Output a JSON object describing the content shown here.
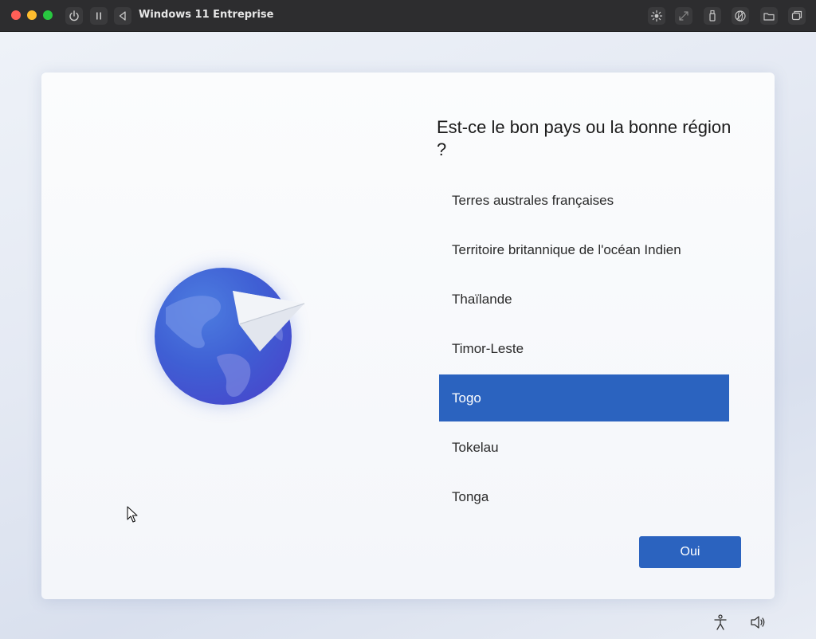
{
  "window": {
    "title": "Windows 11 Entreprise",
    "controls": [
      "power-icon",
      "pause-icon",
      "back-icon"
    ],
    "toolbar_icons": [
      "brightness-icon",
      "resize-icon",
      "usb-icon",
      "network-icon",
      "folder-icon",
      "windows-icon"
    ]
  },
  "setup": {
    "heading": "Est-ce le bon pays ou la bonne région ?",
    "regions": [
      "Terres australes françaises",
      "Territoire britannique de l'océan Indien",
      "Thaïlande",
      "Timor-Leste",
      "Togo",
      "Tokelau",
      "Tonga"
    ],
    "selected": "Togo",
    "confirm_label": "Oui"
  },
  "taskbar_icons": [
    "accessibility-icon",
    "volume-icon"
  ],
  "colors": {
    "accent": "#2b63bf",
    "titlebar": "#2d2d2f"
  }
}
